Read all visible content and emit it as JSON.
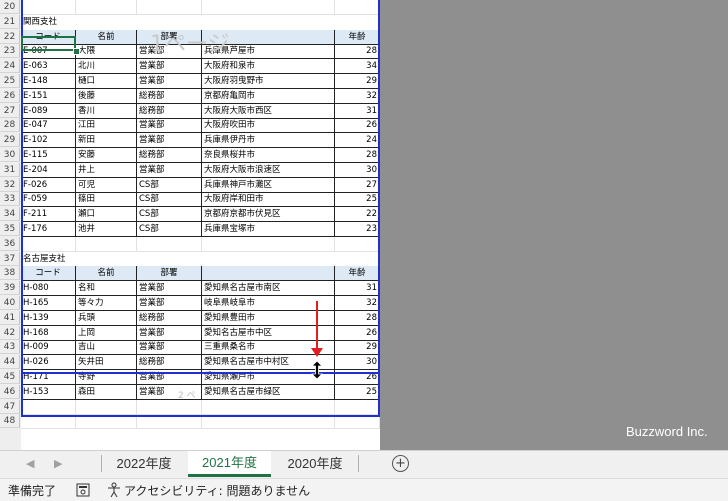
{
  "row_numbers": [
    "20",
    "21",
    "22",
    "23",
    "24",
    "25",
    "26",
    "27",
    "28",
    "29",
    "30",
    "31",
    "32",
    "33",
    "34",
    "35",
    "36",
    "37",
    "38",
    "39",
    "40",
    "41",
    "42",
    "43",
    "44",
    "45",
    "46",
    "47",
    "48"
  ],
  "sections": [
    {
      "title": "関西支社",
      "headers": [
        "コード",
        "名前",
        "部署",
        "",
        "年齢"
      ],
      "rows": [
        [
          "E-007",
          "大隈",
          "営業部",
          "兵庫県芦屋市",
          "28"
        ],
        [
          "E-063",
          "北川",
          "営業部",
          "大阪府和泉市",
          "34"
        ],
        [
          "E-148",
          "樋口",
          "営業部",
          "大阪府羽曳野市",
          "29"
        ],
        [
          "E-151",
          "後藤",
          "総務部",
          "京都府亀岡市",
          "32"
        ],
        [
          "E-089",
          "香川",
          "総務部",
          "大阪府大阪市西区",
          "31"
        ],
        [
          "E-047",
          "江田",
          "営業部",
          "大阪府吹田市",
          "26"
        ],
        [
          "E-102",
          "新田",
          "営業部",
          "兵庫県伊丹市",
          "24"
        ],
        [
          "E-115",
          "安藤",
          "総務部",
          "奈良県桜井市",
          "28"
        ],
        [
          "E-204",
          "井上",
          "営業部",
          "大阪府大阪市浪速区",
          "30"
        ],
        [
          "F-026",
          "可児",
          "CS部",
          "兵庫県神戸市灘区",
          "27"
        ],
        [
          "F-059",
          "篠田",
          "CS部",
          "大阪府岸和田市",
          "25"
        ],
        [
          "F-211",
          "瀬口",
          "CS部",
          "京都府京都市伏見区",
          "22"
        ],
        [
          "F-176",
          "池井",
          "CS部",
          "兵庫県宝塚市",
          "23"
        ]
      ]
    },
    {
      "title": "名古屋支社",
      "headers": [
        "コード",
        "名前",
        "部署",
        "",
        "年齢"
      ],
      "rows": [
        [
          "H-080",
          "名和",
          "営業部",
          "愛知県名古屋市南区",
          "31"
        ],
        [
          "H-165",
          "等々力",
          "営業部",
          "岐阜県岐阜市",
          "32"
        ],
        [
          "H-139",
          "兵頭",
          "総務部",
          "愛知県豊田市",
          "28"
        ],
        [
          "H-168",
          "上岡",
          "営業部",
          "愛知名古屋市中区",
          "26"
        ],
        [
          "H-009",
          "吉山",
          "営業部",
          "三重県桑名市",
          "29"
        ],
        [
          "H-026",
          "矢井田",
          "総務部",
          "愛知県名古屋市中村区",
          "30"
        ],
        [
          "H-171",
          "寺野",
          "営業部",
          "愛知県瀬戸市",
          "26"
        ],
        [
          "H-153",
          "森田",
          "営業部",
          "愛知県名古屋市緑区",
          "25"
        ]
      ]
    }
  ],
  "watermark_page1": "1ページ",
  "watermark_page2": "2 ペ",
  "brand": "Buzzword Inc.",
  "tabs": [
    "2022年度",
    "2021年度",
    "2020年度"
  ],
  "active_tab": "2021年度",
  "add_sheet_label": "+",
  "nav_prev": "◀",
  "nav_next": "▶",
  "status": {
    "ready": "準備完了",
    "accessibility": "アクセシビリティ: 問題ありません"
  },
  "colors": {
    "page_break_border": "#1f2fd1",
    "header_fill": "#dde9f5",
    "accent": "#217346",
    "arrow": "#e02020"
  }
}
